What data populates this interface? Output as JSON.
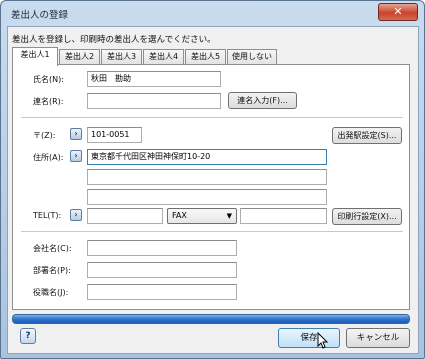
{
  "window": {
    "title": "差出人の登録",
    "close_icon": "✕"
  },
  "instruction": "差出人を登録し、印刷時の差出人を選んでください。",
  "tabs": [
    "差出人1",
    "差出人2",
    "差出人3",
    "差出人4",
    "差出人5",
    "使用しない"
  ],
  "active_tab": 0,
  "form": {
    "name_label": "氏名(N):",
    "name_value": "秋田　勘助",
    "joint_label": "連名(R):",
    "joint_value": "",
    "joint_button": "連名入力(F)...",
    "zip_label": "〒(Z):",
    "zip_value": "101-0051",
    "station_button": "出発駅設定(S)...",
    "address_label": "住所(A):",
    "address_line1": "東京都千代田区神田神保町10-20",
    "address_line2": "",
    "address_line3": "",
    "tel_label": "TEL(T):",
    "tel_value": "",
    "fax_option": "FAX",
    "fax_value": "",
    "print_line_button": "印刷行設定(X)...",
    "company_label": "会社名(C):",
    "company_value": "",
    "dept_label": "部署名(P):",
    "dept_value": "",
    "title_label": "役職名(J):",
    "title_value": ""
  },
  "footer": {
    "help_icon": "?",
    "save_button": "保存",
    "cancel_button": "キャンセル"
  },
  "expand_arrow": "›",
  "dropdown_arrow": "▼"
}
